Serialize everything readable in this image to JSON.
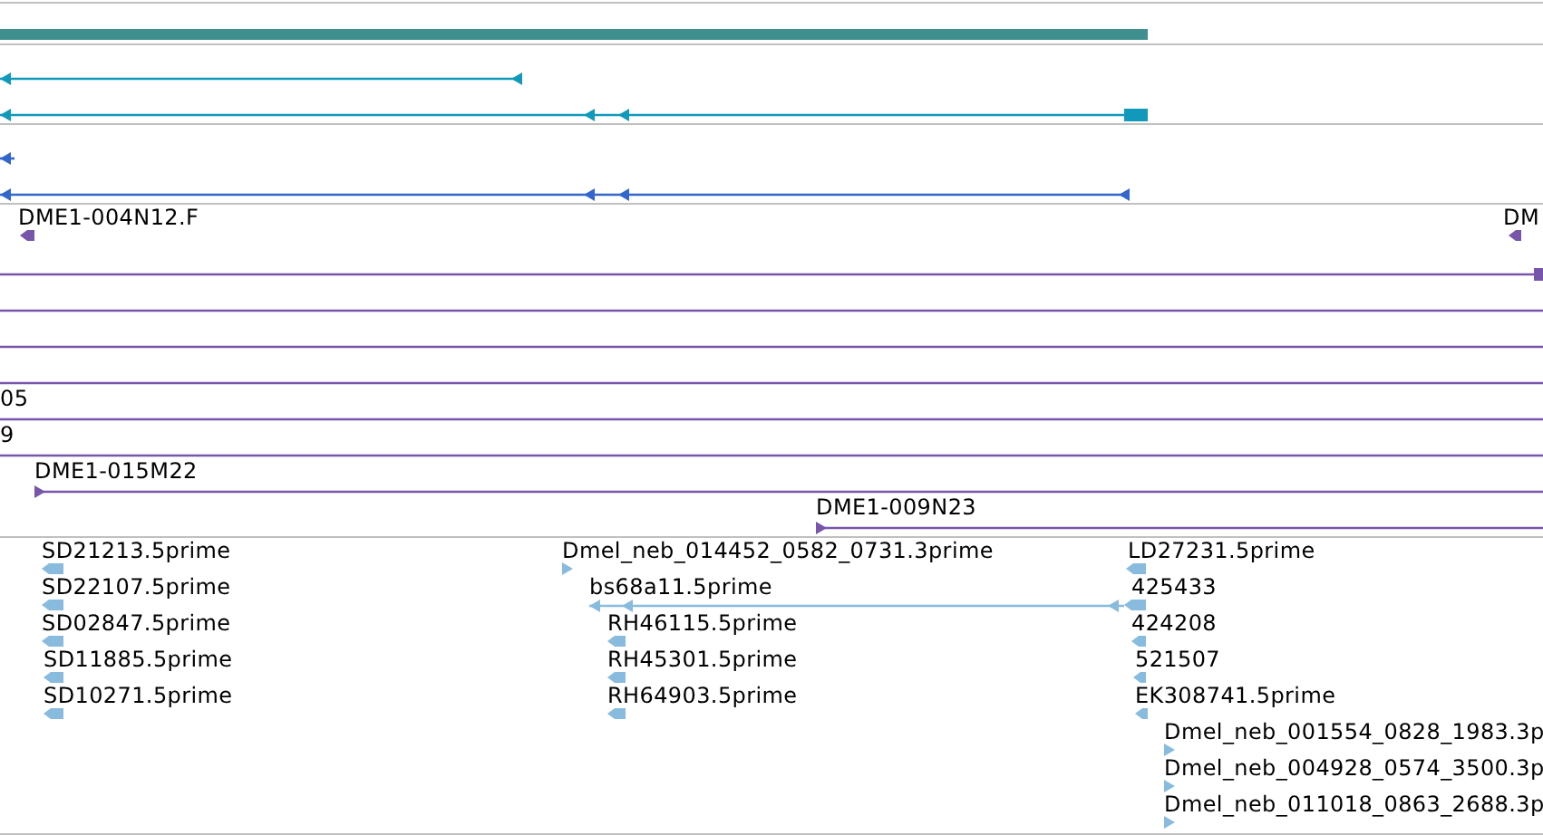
{
  "tracks": [
    {
      "kind": "bar",
      "color": "#3f8f8f"
    },
    {
      "kind": "gene",
      "color": "#1199bb",
      "features": [
        {
          "forward": false
        },
        {
          "forward": false
        }
      ]
    },
    {
      "kind": "gene",
      "color": "#3366cc",
      "features": [
        {
          "forward": false
        },
        {
          "forward": false
        }
      ]
    },
    {
      "kind": "clone",
      "color": "#7755aa",
      "features": [
        {
          "kind": "arrow",
          "label": "DME1-004N12.F",
          "forward": false
        },
        {
          "kind": "arrow",
          "label": "DM",
          "forward": false
        },
        {
          "kind": "span"
        },
        {
          "kind": "span"
        },
        {
          "kind": "span"
        },
        {
          "kind": "span"
        },
        {
          "kind": "span",
          "label": "05"
        },
        {
          "kind": "span",
          "label": "9"
        },
        {
          "kind": "span",
          "label": "DME1-015M22",
          "forward": true
        },
        {
          "kind": "span",
          "label": "DME1-009N23",
          "forward": true
        }
      ]
    },
    {
      "kind": "est",
      "color": "#88bbdd",
      "features": [
        {
          "label": "SD21213.5prime",
          "forward": false
        },
        {
          "label": "SD22107.5prime",
          "forward": false
        },
        {
          "label": "SD02847.5prime",
          "forward": false
        },
        {
          "label": "SD11885.5prime",
          "forward": false
        },
        {
          "label": "SD10271.5prime",
          "forward": false
        },
        {
          "label": "Dmel_neb_014452_0582_0731.3prime",
          "forward": true
        },
        {
          "label": "bs68a11.5prime",
          "forward": false
        },
        {
          "label": "RH46115.5prime",
          "forward": false
        },
        {
          "label": "RH45301.5prime",
          "forward": false
        },
        {
          "label": "RH64903.5prime",
          "forward": false
        },
        {
          "label": "LD27231.5prime",
          "forward": false
        },
        {
          "label": "425433",
          "forward": false
        },
        {
          "label": "424208",
          "forward": false
        },
        {
          "label": "521507",
          "forward": false
        },
        {
          "label": "EK308741.5prime",
          "forward": false
        },
        {
          "label": "Dmel_neb_001554_0828_1983.3p",
          "forward": true
        },
        {
          "label": "Dmel_neb_004928_0574_3500.3p",
          "forward": true
        },
        {
          "label": "Dmel_neb_011018_0863_2688.3p",
          "forward": true
        }
      ]
    }
  ]
}
